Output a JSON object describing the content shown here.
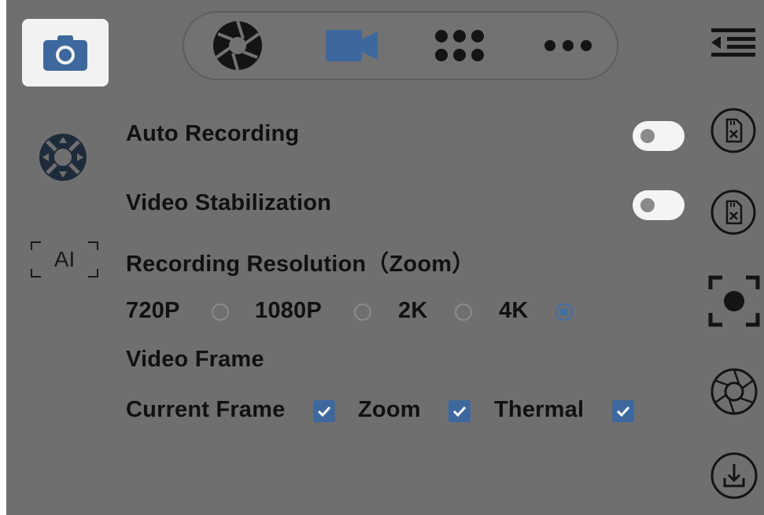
{
  "sidebar": {
    "left": {
      "camera_button_icon": "camera-icon",
      "gimbal_icon": "dpad-icon",
      "ai_label": "AI"
    }
  },
  "modebar": {
    "modes": [
      {
        "icon": "aperture-icon",
        "active": false
      },
      {
        "icon": "video-camera-icon",
        "active": true
      },
      {
        "icon": "grid-dots-icon",
        "active": false
      },
      {
        "icon": "more-dots-icon",
        "active": false
      }
    ]
  },
  "settings": {
    "auto_recording": {
      "label": "Auto Recording",
      "enabled": false
    },
    "video_stabilization": {
      "label": "Video Stabilization",
      "enabled": false
    },
    "recording_resolution": {
      "label": "Recording Resolution（Zoom）",
      "options": [
        "720P",
        "1080P",
        "2K",
        "4K"
      ],
      "selected": "4K"
    },
    "video_frame": {
      "label": "Video Frame",
      "options": [
        {
          "label": "Current Frame",
          "checked": true
        },
        {
          "label": "Zoom",
          "checked": true
        },
        {
          "label": "Thermal",
          "checked": true
        }
      ]
    }
  },
  "right_toolbar": {
    "icons": [
      "collapse-menu-icon",
      "sd-card-remove-icon",
      "sd-card-remove-icon",
      "focus-target-icon",
      "shutter-wheel-icon",
      "download-icon"
    ]
  },
  "colors": {
    "overlay": "#6f6f6f",
    "accent": "#3d689d",
    "text": "#111111"
  }
}
